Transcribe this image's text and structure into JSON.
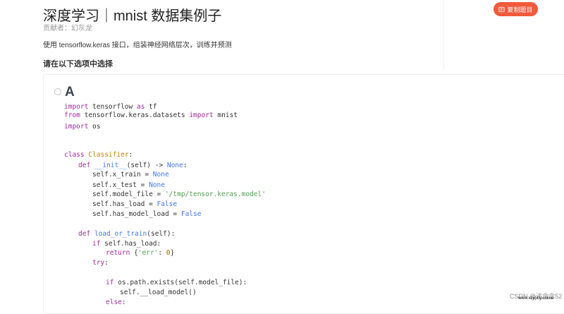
{
  "header": {
    "title": "深度学习｜mnist 数据集例子",
    "author": "贡献者：幻灰龙",
    "description": "使用 tensorflow.keras 接口，组装神经网络层次，训练并预测"
  },
  "copy_button": {
    "label": "复制题目",
    "icon": "copy-icon"
  },
  "question": {
    "prompt": "请在以下选项中选择"
  },
  "option": {
    "letter": "A",
    "lines": [
      [
        {
          "t": "import",
          "c": "kw"
        },
        {
          "t": " tensorflow ",
          "c": ""
        },
        {
          "t": "as",
          "c": "kw"
        },
        {
          "t": " tf",
          "c": ""
        }
      ],
      [
        {
          "t": "from",
          "c": "kw"
        },
        {
          "t": " tensorflow.keras.datasets ",
          "c": ""
        },
        {
          "t": "import",
          "c": "kw"
        },
        {
          "t": " mnist",
          "c": ""
        }
      ],
      [
        {
          "t": "import",
          "c": "kw"
        },
        {
          "t": " os",
          "c": ""
        }
      ],
      [
        {
          "t": "class ",
          "c": "kw"
        },
        {
          "t": "Classifier",
          "c": "cls"
        },
        {
          "t": ":",
          "c": ""
        }
      ],
      [
        {
          "t": "def ",
          "c": "kw"
        },
        {
          "t": "__init__",
          "c": "fn"
        },
        {
          "t": "(self) -> ",
          "c": ""
        },
        {
          "t": "None",
          "c": "kw2"
        },
        {
          "t": ":",
          "c": ""
        }
      ],
      [
        {
          "t": "self.x_train = ",
          "c": ""
        },
        {
          "t": "None",
          "c": "kw2"
        }
      ],
      [
        {
          "t": "self.x_test = ",
          "c": ""
        },
        {
          "t": "None",
          "c": "kw2"
        }
      ],
      [
        {
          "t": "self.model_file = ",
          "c": ""
        },
        {
          "t": "'/tmp/tensor.keras.model'",
          "c": "str"
        }
      ],
      [
        {
          "t": "self.has_load = ",
          "c": ""
        },
        {
          "t": "False",
          "c": "kw2"
        }
      ],
      [
        {
          "t": "self.has_model_load = ",
          "c": ""
        },
        {
          "t": "False",
          "c": "kw2"
        }
      ],
      [
        {
          "t": "def ",
          "c": "kw"
        },
        {
          "t": "load_or_train",
          "c": "fn"
        },
        {
          "t": "(self):",
          "c": ""
        }
      ],
      [
        {
          "t": "if",
          "c": "kw"
        },
        {
          "t": " self.has_load:",
          "c": ""
        }
      ],
      [
        {
          "t": "return",
          "c": "kw"
        },
        {
          "t": " {",
          "c": ""
        },
        {
          "t": "'err'",
          "c": "str"
        },
        {
          "t": ": ",
          "c": ""
        },
        {
          "t": "0",
          "c": "num"
        },
        {
          "t": "}",
          "c": ""
        }
      ],
      [
        {
          "t": "try",
          "c": "kw"
        },
        {
          "t": ":",
          "c": ""
        }
      ],
      [
        {
          "t": "if",
          "c": "kw"
        },
        {
          "t": " os.path.exists(self.model_file):",
          "c": ""
        }
      ],
      [
        {
          "t": "self.__load_model()",
          "c": ""
        }
      ],
      [
        {
          "t": "else",
          "c": "kw"
        },
        {
          "t": ":",
          "c": ""
        }
      ]
    ]
  },
  "watermark": {
    "text": "CSDN @浅念念52",
    "site": "www.xzyphy.online"
  }
}
